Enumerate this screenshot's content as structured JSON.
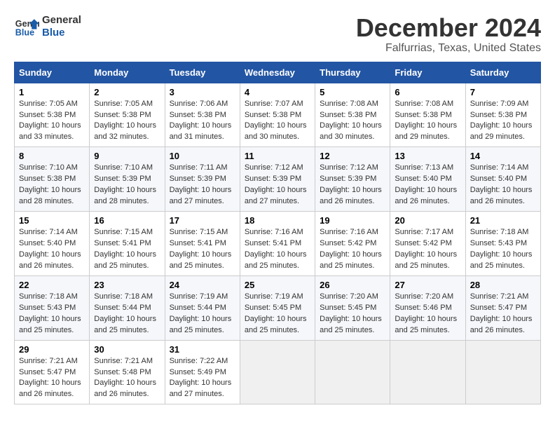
{
  "logo": {
    "line1": "General",
    "line2": "Blue"
  },
  "title": "December 2024",
  "subtitle": "Falfurrias, Texas, United States",
  "days_of_week": [
    "Sunday",
    "Monday",
    "Tuesday",
    "Wednesday",
    "Thursday",
    "Friday",
    "Saturday"
  ],
  "weeks": [
    [
      {
        "day": "1",
        "info": "Sunrise: 7:05 AM\nSunset: 5:38 PM\nDaylight: 10 hours\nand 33 minutes."
      },
      {
        "day": "2",
        "info": "Sunrise: 7:05 AM\nSunset: 5:38 PM\nDaylight: 10 hours\nand 32 minutes."
      },
      {
        "day": "3",
        "info": "Sunrise: 7:06 AM\nSunset: 5:38 PM\nDaylight: 10 hours\nand 31 minutes."
      },
      {
        "day": "4",
        "info": "Sunrise: 7:07 AM\nSunset: 5:38 PM\nDaylight: 10 hours\nand 30 minutes."
      },
      {
        "day": "5",
        "info": "Sunrise: 7:08 AM\nSunset: 5:38 PM\nDaylight: 10 hours\nand 30 minutes."
      },
      {
        "day": "6",
        "info": "Sunrise: 7:08 AM\nSunset: 5:38 PM\nDaylight: 10 hours\nand 29 minutes."
      },
      {
        "day": "7",
        "info": "Sunrise: 7:09 AM\nSunset: 5:38 PM\nDaylight: 10 hours\nand 29 minutes."
      }
    ],
    [
      {
        "day": "8",
        "info": "Sunrise: 7:10 AM\nSunset: 5:38 PM\nDaylight: 10 hours\nand 28 minutes."
      },
      {
        "day": "9",
        "info": "Sunrise: 7:10 AM\nSunset: 5:39 PM\nDaylight: 10 hours\nand 28 minutes."
      },
      {
        "day": "10",
        "info": "Sunrise: 7:11 AM\nSunset: 5:39 PM\nDaylight: 10 hours\nand 27 minutes."
      },
      {
        "day": "11",
        "info": "Sunrise: 7:12 AM\nSunset: 5:39 PM\nDaylight: 10 hours\nand 27 minutes."
      },
      {
        "day": "12",
        "info": "Sunrise: 7:12 AM\nSunset: 5:39 PM\nDaylight: 10 hours\nand 26 minutes."
      },
      {
        "day": "13",
        "info": "Sunrise: 7:13 AM\nSunset: 5:40 PM\nDaylight: 10 hours\nand 26 minutes."
      },
      {
        "day": "14",
        "info": "Sunrise: 7:14 AM\nSunset: 5:40 PM\nDaylight: 10 hours\nand 26 minutes."
      }
    ],
    [
      {
        "day": "15",
        "info": "Sunrise: 7:14 AM\nSunset: 5:40 PM\nDaylight: 10 hours\nand 26 minutes."
      },
      {
        "day": "16",
        "info": "Sunrise: 7:15 AM\nSunset: 5:41 PM\nDaylight: 10 hours\nand 25 minutes."
      },
      {
        "day": "17",
        "info": "Sunrise: 7:15 AM\nSunset: 5:41 PM\nDaylight: 10 hours\nand 25 minutes."
      },
      {
        "day": "18",
        "info": "Sunrise: 7:16 AM\nSunset: 5:41 PM\nDaylight: 10 hours\nand 25 minutes."
      },
      {
        "day": "19",
        "info": "Sunrise: 7:16 AM\nSunset: 5:42 PM\nDaylight: 10 hours\nand 25 minutes."
      },
      {
        "day": "20",
        "info": "Sunrise: 7:17 AM\nSunset: 5:42 PM\nDaylight: 10 hours\nand 25 minutes."
      },
      {
        "day": "21",
        "info": "Sunrise: 7:18 AM\nSunset: 5:43 PM\nDaylight: 10 hours\nand 25 minutes."
      }
    ],
    [
      {
        "day": "22",
        "info": "Sunrise: 7:18 AM\nSunset: 5:43 PM\nDaylight: 10 hours\nand 25 minutes."
      },
      {
        "day": "23",
        "info": "Sunrise: 7:18 AM\nSunset: 5:44 PM\nDaylight: 10 hours\nand 25 minutes."
      },
      {
        "day": "24",
        "info": "Sunrise: 7:19 AM\nSunset: 5:44 PM\nDaylight: 10 hours\nand 25 minutes."
      },
      {
        "day": "25",
        "info": "Sunrise: 7:19 AM\nSunset: 5:45 PM\nDaylight: 10 hours\nand 25 minutes."
      },
      {
        "day": "26",
        "info": "Sunrise: 7:20 AM\nSunset: 5:45 PM\nDaylight: 10 hours\nand 25 minutes."
      },
      {
        "day": "27",
        "info": "Sunrise: 7:20 AM\nSunset: 5:46 PM\nDaylight: 10 hours\nand 25 minutes."
      },
      {
        "day": "28",
        "info": "Sunrise: 7:21 AM\nSunset: 5:47 PM\nDaylight: 10 hours\nand 26 minutes."
      }
    ],
    [
      {
        "day": "29",
        "info": "Sunrise: 7:21 AM\nSunset: 5:47 PM\nDaylight: 10 hours\nand 26 minutes."
      },
      {
        "day": "30",
        "info": "Sunrise: 7:21 AM\nSunset: 5:48 PM\nDaylight: 10 hours\nand 26 minutes."
      },
      {
        "day": "31",
        "info": "Sunrise: 7:22 AM\nSunset: 5:49 PM\nDaylight: 10 hours\nand 27 minutes."
      },
      {
        "day": "",
        "info": ""
      },
      {
        "day": "",
        "info": ""
      },
      {
        "day": "",
        "info": ""
      },
      {
        "day": "",
        "info": ""
      }
    ]
  ]
}
